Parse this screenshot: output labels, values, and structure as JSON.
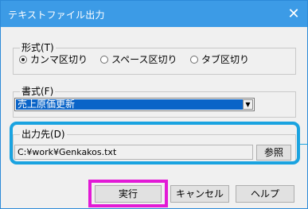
{
  "window": {
    "title": "テキストファイル出力",
    "close_icon": "✕"
  },
  "format_group": {
    "label": "形式(T)",
    "options": [
      {
        "label": "カンマ区切り",
        "selected": true
      },
      {
        "label": "スペース区切り",
        "selected": false
      },
      {
        "label": "タブ区切り",
        "selected": false
      }
    ]
  },
  "style_group": {
    "label": "書式(F)",
    "selected_value": "売上原価更新",
    "dropdown_icon": "▼"
  },
  "output_group": {
    "label": "出力先(D)",
    "path_value": "C:¥work¥Genkakos.txt",
    "browse_label": "参照"
  },
  "buttons": {
    "run": "実行",
    "cancel": "キャンセル",
    "help": "ヘルプ"
  },
  "colors": {
    "titlebar": "#3c9be6",
    "highlight_blue": "#1aa3e0",
    "highlight_magenta": "#e21ad6",
    "selection": "#0a64c8"
  }
}
